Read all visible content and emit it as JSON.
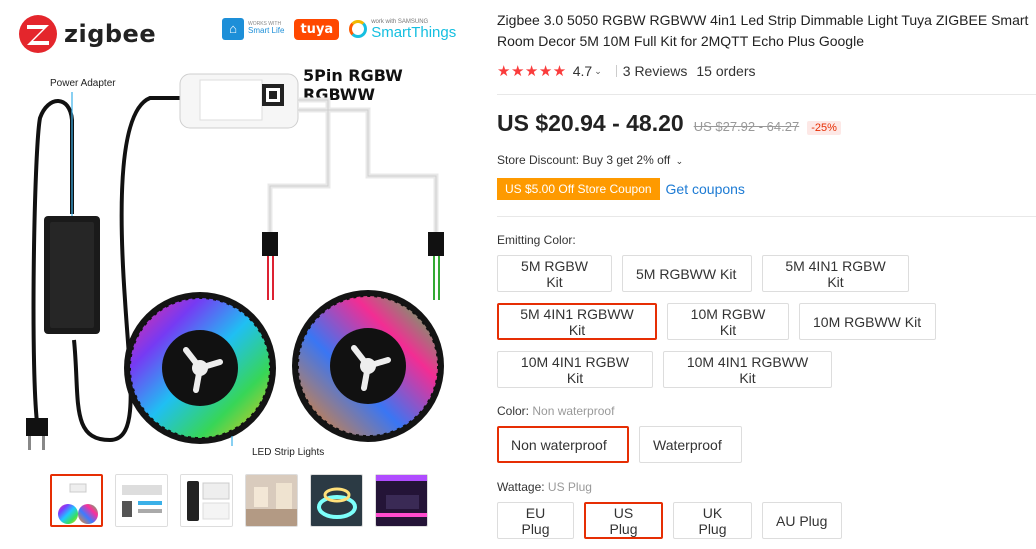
{
  "gallery": {
    "brand": "zigbee",
    "partner_logos": {
      "smartlife_small": "WORKS WITH",
      "smartlife": "Smart Life",
      "tuya": "tuya",
      "smartthings_small": "work with SAMSUNG",
      "smartthings": "SmartThings"
    },
    "labels": {
      "power_adapter": "Power Adapter",
      "pin_title": "5Pin RGBW RGBWW",
      "led_strip_lights": "LED Strip Lights"
    },
    "thumbnails": [
      {
        "name": "thumb-1",
        "active": true
      },
      {
        "name": "thumb-2",
        "active": false
      },
      {
        "name": "thumb-3",
        "active": false
      },
      {
        "name": "thumb-4",
        "active": false
      },
      {
        "name": "thumb-5",
        "active": false
      },
      {
        "name": "thumb-6",
        "active": false
      }
    ]
  },
  "product": {
    "title": "Zigbee 3.0 5050 RGBW RGBWW 4in1 Led Strip Dimmable Light Tuya ZIGBEE Smart Room Decor 5M 10M Full Kit for 2MQTT Echo Plus Google",
    "stars": "★★★★★",
    "rating": "4.7",
    "reviews": "3 Reviews",
    "orders": "15 orders",
    "price": "US $20.94 - 48.20",
    "original_price": "US $27.92 - 64.27",
    "discount": "-25%",
    "store_discount": "Store Discount: Buy 3 get 2% off",
    "coupon": "US $5.00 Off Store Coupon",
    "get_coupons": "Get coupons"
  },
  "emitting_color": {
    "label": "Emitting Color:",
    "rows": [
      [
        "5M RGBW Kit",
        "5M RGBWW Kit",
        "5M 4IN1 RGBW Kit"
      ],
      [
        "5M 4IN1 RGBWW Kit",
        "10M RGBW Kit",
        "10M RGBWW Kit"
      ],
      [
        "10M 4IN1 RGBW Kit",
        "10M 4IN1 RGBWW Kit"
      ]
    ],
    "selected": "5M 4IN1 RGBWW Kit"
  },
  "color": {
    "label": "Color:",
    "selected_label": "Non waterproof",
    "options": [
      "Non waterproof",
      "Waterproof"
    ]
  },
  "wattage": {
    "label": "Wattage:",
    "selected_label": "US Plug",
    "options": [
      "EU Plug",
      "US Plug",
      "UK Plug",
      "AU Plug"
    ]
  },
  "colors": {
    "accent_red": "#e62e04",
    "star_red": "#fa3c3c",
    "coupon_orange": "#fe9a00",
    "link_blue": "#1d7bd4"
  }
}
